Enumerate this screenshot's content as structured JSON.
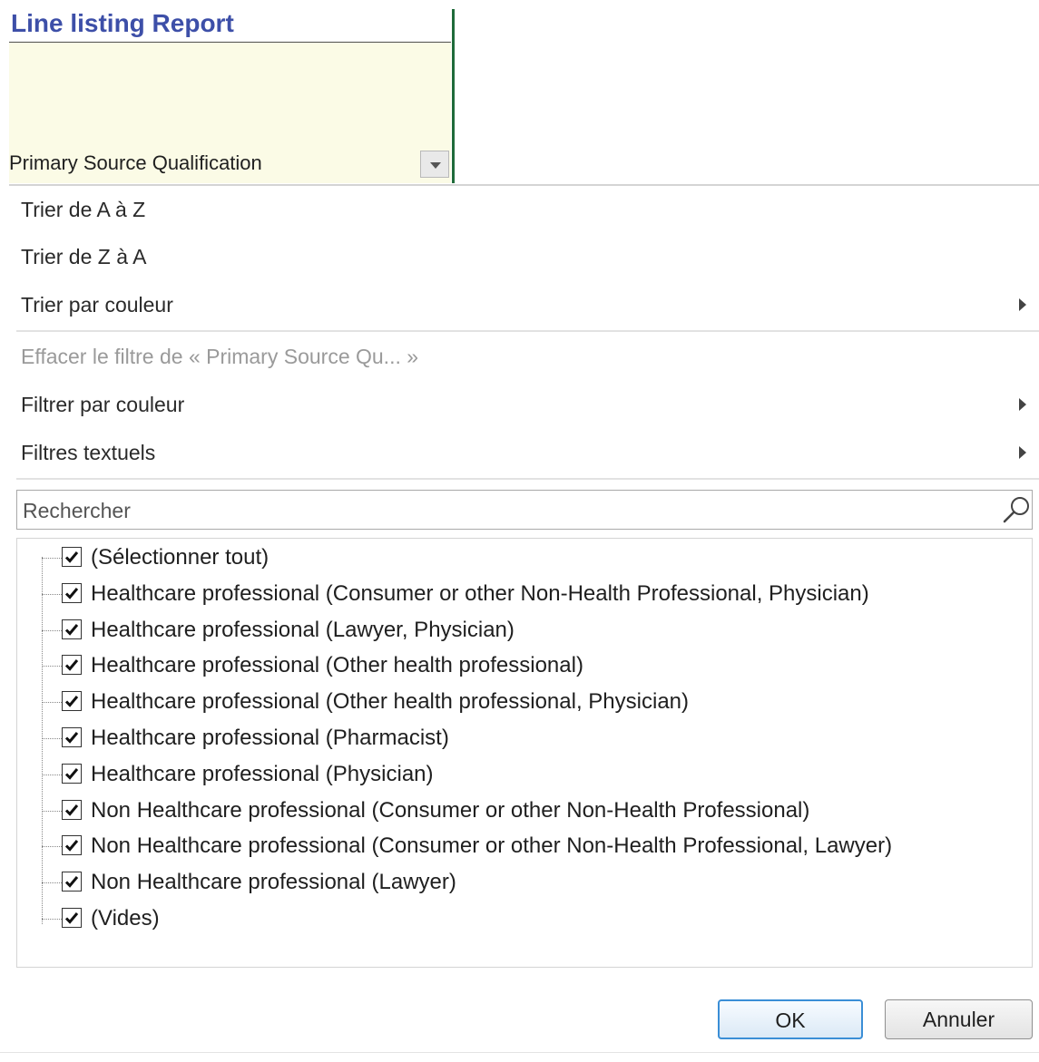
{
  "sheet": {
    "report_title": "Line listing Report",
    "column_header": "Primary Source Qualification"
  },
  "menu": {
    "sort_az": "Trier de A à Z",
    "sort_za": "Trier de Z à A",
    "sort_by_color": "Trier par couleur",
    "clear_filter": "Effacer le filtre de « Primary Source Qu... »",
    "filter_by_color": "Filtrer par couleur",
    "text_filters": "Filtres textuels"
  },
  "search": {
    "placeholder": "Rechercher"
  },
  "items": [
    {
      "label": "(Sélectionner tout)",
      "checked": true
    },
    {
      "label": "Healthcare professional (Consumer or other Non-Health Professional, Physician)",
      "checked": true
    },
    {
      "label": "Healthcare professional (Lawyer, Physician)",
      "checked": true
    },
    {
      "label": "Healthcare professional (Other health professional)",
      "checked": true
    },
    {
      "label": "Healthcare professional (Other health professional, Physician)",
      "checked": true
    },
    {
      "label": "Healthcare professional (Pharmacist)",
      "checked": true
    },
    {
      "label": "Healthcare professional (Physician)",
      "checked": true
    },
    {
      "label": "Non Healthcare professional (Consumer or other Non-Health Professional)",
      "checked": true
    },
    {
      "label": "Non Healthcare professional (Consumer or other Non-Health Professional, Lawyer)",
      "checked": true
    },
    {
      "label": "Non Healthcare professional (Lawyer)",
      "checked": true
    },
    {
      "label": "(Vides)",
      "checked": true
    }
  ],
  "buttons": {
    "ok": "OK",
    "cancel": "Annuler"
  },
  "colors": {
    "title": "#3d4fa8",
    "header_fill": "#fbfbe6",
    "column_border": "#1f6b3a",
    "ok_border": "#3a8ed6"
  }
}
